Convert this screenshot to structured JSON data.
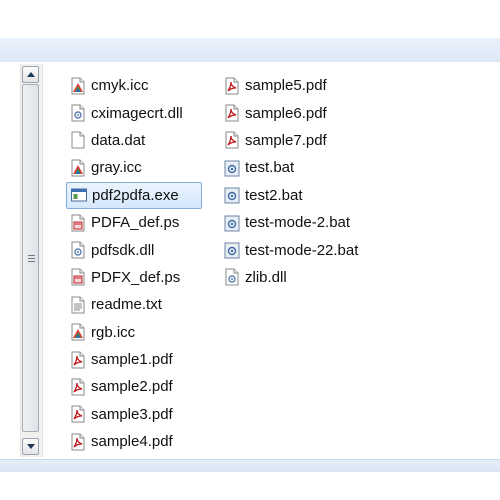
{
  "files": {
    "column1": [
      {
        "name": "cmyk.icc",
        "icon": "icc-icon"
      },
      {
        "name": "cximagecrt.dll",
        "icon": "dll-icon"
      },
      {
        "name": "data.dat",
        "icon": "blank-file-icon"
      },
      {
        "name": "gray.icc",
        "icon": "icc-icon"
      },
      {
        "name": "pdf2pdfa.exe",
        "icon": "exe-icon",
        "selected": true
      },
      {
        "name": "PDFA_def.ps",
        "icon": "ps-icon"
      },
      {
        "name": "pdfsdk.dll",
        "icon": "dll-icon"
      },
      {
        "name": "PDFX_def.ps",
        "icon": "ps-icon"
      },
      {
        "name": "readme.txt",
        "icon": "txt-icon"
      },
      {
        "name": "rgb.icc",
        "icon": "icc-icon"
      },
      {
        "name": "sample1.pdf",
        "icon": "pdf-icon"
      },
      {
        "name": "sample2.pdf",
        "icon": "pdf-icon"
      },
      {
        "name": "sample3.pdf",
        "icon": "pdf-icon"
      },
      {
        "name": "sample4.pdf",
        "icon": "pdf-icon"
      }
    ],
    "column2": [
      {
        "name": "sample5.pdf",
        "icon": "pdf-icon"
      },
      {
        "name": "sample6.pdf",
        "icon": "pdf-icon"
      },
      {
        "name": "sample7.pdf",
        "icon": "pdf-icon"
      },
      {
        "name": "test.bat",
        "icon": "bat-icon"
      },
      {
        "name": "test2.bat",
        "icon": "bat-icon"
      },
      {
        "name": "test-mode-2.bat",
        "icon": "bat-icon"
      },
      {
        "name": "test-mode-22.bat",
        "icon": "bat-icon"
      },
      {
        "name": "zlib.dll",
        "icon": "dll-icon"
      }
    ]
  },
  "colors": {
    "pdf_red": "#c4161c",
    "selection_border": "#84acdd",
    "selection_fill": "#d5e8fb"
  }
}
